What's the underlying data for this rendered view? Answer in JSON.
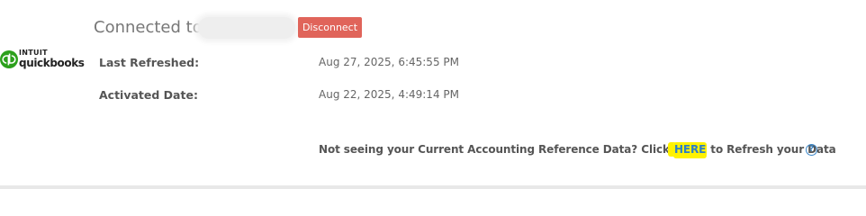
{
  "logo": {
    "brand_top": "INTUIT",
    "brand_name": "quickbooks",
    "mark_color": "#2ca01c"
  },
  "connection": {
    "label": "Connected to:",
    "disconnect_label": "Disconnect",
    "disconnect_color": "#e0645a"
  },
  "details": {
    "last_refreshed_label": "Last Refreshed:",
    "last_refreshed_value": "Aug 27, 2025, 6:45:55 PM",
    "activated_label": "Activated Date:",
    "activated_value": "Aug 22, 2025, 4:49:14 PM"
  },
  "refresh": {
    "text_before": "Not seeing your Current Accounting Reference Data? Click ",
    "link_text": "HERE",
    "text_after": " to Refresh your Data",
    "link_color": "#2e7fc5",
    "highlight_color": "#fff200",
    "help_icon": "question-circle-icon",
    "help_glyph": "?"
  }
}
